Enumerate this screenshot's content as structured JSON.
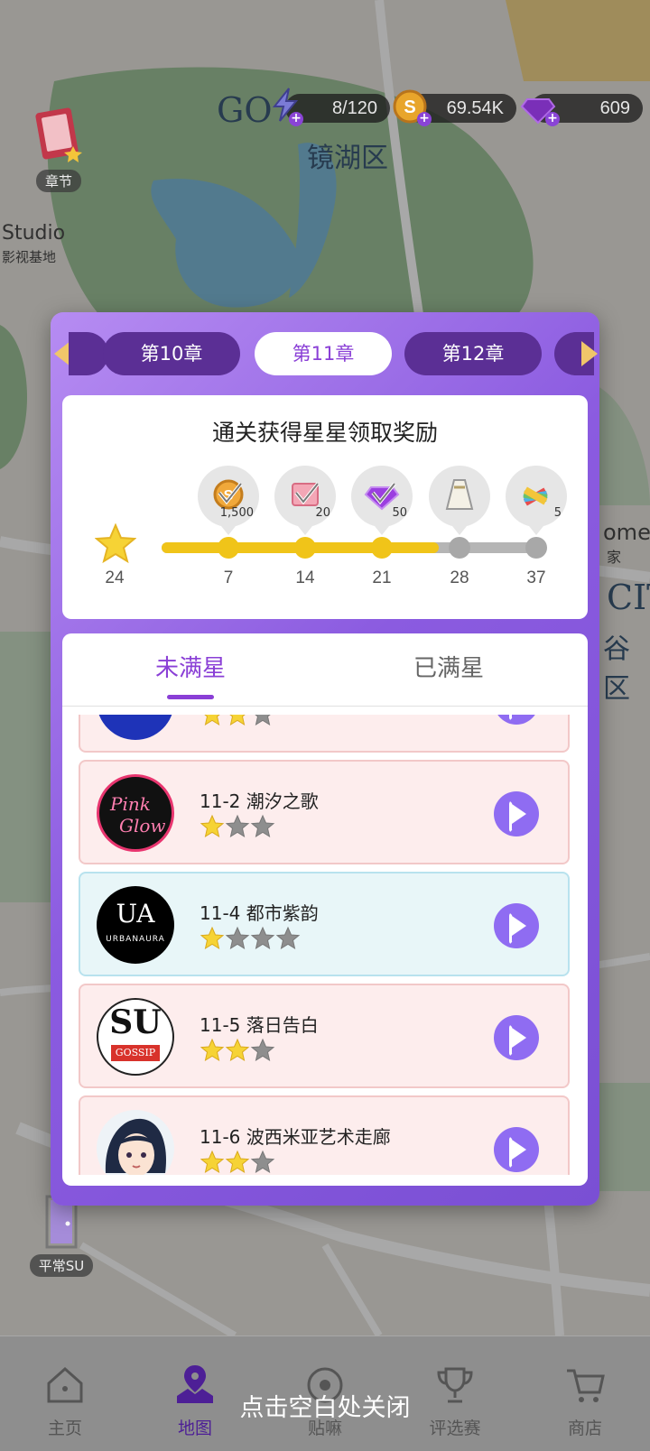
{
  "resources": {
    "energy": "8/120",
    "coins": "69.54K",
    "gems": "609"
  },
  "map": {
    "district_cn": "镜湖区",
    "district_en_partial": "GO",
    "studio_en": "Studio",
    "studio_cn": "影视基地",
    "home_en": "ome",
    "home_cn": "家",
    "city_en": "CIT",
    "valley_cn": "谷区"
  },
  "side": {
    "chapters_label": "章节",
    "ordinary_su_label": "平常SU"
  },
  "chapter_tabs": {
    "prev_partial": "",
    "items": [
      {
        "label": "第10章"
      },
      {
        "label": "第11章"
      },
      {
        "label": "第12章"
      }
    ]
  },
  "reward_panel": {
    "title": "通关获得星星领取奖励",
    "current_stars": "24",
    "progress_fraction": 0.73,
    "milestones": [
      {
        "stars": "7",
        "reward_qty": "1,500",
        "reward_icon": "coin-icon",
        "reached": true
      },
      {
        "stars": "14",
        "reward_qty": "20",
        "reward_icon": "ticket-icon",
        "reached": true
      },
      {
        "stars": "21",
        "reward_qty": "50",
        "reward_icon": "gem-icon",
        "reached": true
      },
      {
        "stars": "28",
        "reward_qty": "",
        "reward_icon": "dress-icon",
        "reached": false
      },
      {
        "stars": "37",
        "reward_qty": "5",
        "reward_icon": "color-palette-icon",
        "reached": false
      }
    ]
  },
  "level_tabs": {
    "unfinished": "未满星",
    "finished": "已满星"
  },
  "levels": [
    {
      "name": "",
      "stars_earned": 2,
      "stars_total": 3,
      "logo": "ublue-logo",
      "partial": true
    },
    {
      "name": "11-2 潮汐之歌",
      "stars_earned": 1,
      "stars_total": 3,
      "logo": "pink-glow-logo"
    },
    {
      "name": "11-4 都市紫韵",
      "stars_earned": 1,
      "stars_total": 4,
      "logo": "urbanaura-logo",
      "current": true
    },
    {
      "name": "11-5 落日告白",
      "stars_earned": 2,
      "stars_total": 3,
      "logo": "su-gossip-logo"
    },
    {
      "name": "11-6 波西米亚艺术走廊",
      "stars_earned": 2,
      "stars_total": 3,
      "logo": "artist-avatar"
    }
  ],
  "logo_text": {
    "pink_glow_1": "Pink",
    "pink_glow_2": "Glow",
    "urbanaura_mark": "UA",
    "urbanaura_name": "URBANAURA",
    "su": "SU",
    "gossip": "GOSSIP"
  },
  "bottom_nav": [
    {
      "label": "主页",
      "icon": "home-icon"
    },
    {
      "label": "地图",
      "icon": "map-pin-icon",
      "active": true
    },
    {
      "label": "贴嘛",
      "icon": "record-icon"
    },
    {
      "label": "评选赛",
      "icon": "trophy-icon"
    },
    {
      "label": "商店",
      "icon": "cart-icon"
    }
  ],
  "close_hint": "点击空白处关闭",
  "colors": {
    "accent_purple": "#8a3fd6",
    "gold": "#f0c419",
    "level_pink_bg": "#fdeded",
    "level_blue_bg": "#e8f6f8"
  }
}
